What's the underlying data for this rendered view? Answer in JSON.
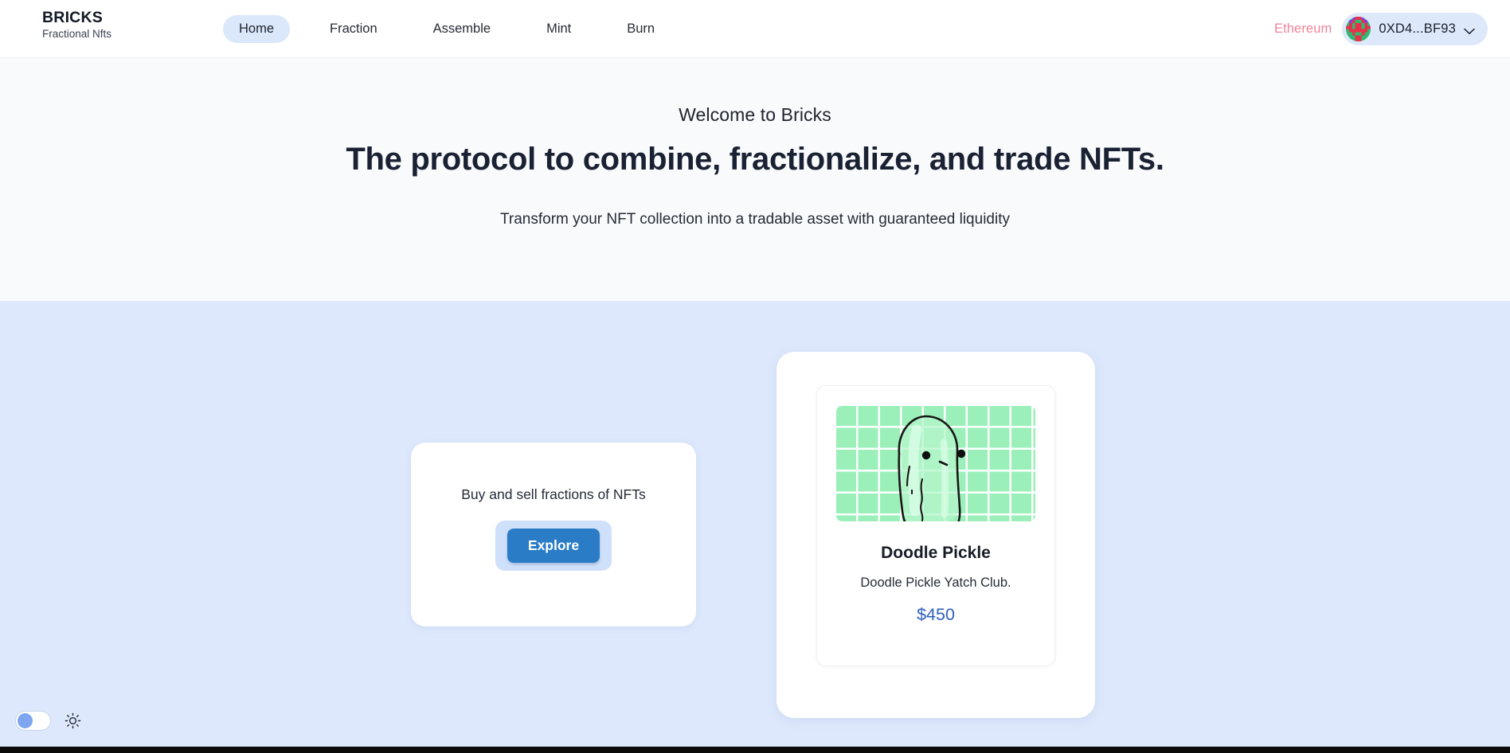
{
  "header": {
    "brand_name": "BRICKS",
    "brand_tagline": "Fractional Nfts",
    "nav_items": [
      {
        "label": "Home",
        "active": true
      },
      {
        "label": "Fraction",
        "active": false
      },
      {
        "label": "Assemble",
        "active": false
      },
      {
        "label": "Mint",
        "active": false
      },
      {
        "label": "Burn",
        "active": false
      }
    ],
    "chain": "Ethereum",
    "wallet_address": "0XD4...BF93",
    "chain_color": "#f0849a",
    "active_pill_color": "#dbe7fb",
    "wallet_pill_color": "#dde8fb"
  },
  "hero": {
    "eyebrow": "Welcome to Bricks",
    "title": "The protocol to combine, fractionalize, and trade NFTs.",
    "subtitle": "Transform your NFT collection into a tradable asset with guaranteed liquidity",
    "background_color": "#f9fafc"
  },
  "panel": {
    "background_color": "#dde8fc",
    "cta": {
      "text": "Buy and sell fractions of NFTs",
      "button_label": "Explore",
      "button_color": "#2a7cc7",
      "button_ring_color": "#cfe0fa"
    },
    "nft": {
      "name": "Doodle Pickle",
      "description": "Doodle Pickle Yatch Club.",
      "price": "$450",
      "price_color": "#2e5fc0",
      "art_background_color": "#9af0b8",
      "art_alt": "doodle-pickle-artwork"
    }
  },
  "footer": {
    "theme_toggle_state": "off",
    "theme_toggle_knob_color": "#7ea6ee",
    "sun_icon_name": "sun-icon"
  }
}
